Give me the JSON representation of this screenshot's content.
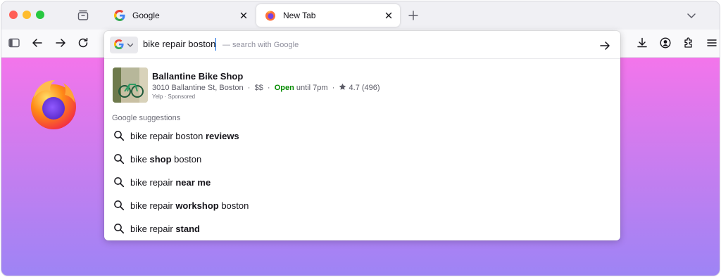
{
  "tabs": [
    {
      "title": "Google",
      "favicon": "google-g-icon",
      "active": false
    },
    {
      "title": "New Tab",
      "favicon": "firefox-icon",
      "active": true
    }
  ],
  "urlbar": {
    "value": "bike repair boston",
    "hint": "— search with Google",
    "engine_icon": "google-g-icon"
  },
  "business": {
    "name": "Ballantine Bike Shop",
    "address": "3010 Ballantine St, Boston",
    "price": "$$",
    "open_label": "Open",
    "hours": "until 7pm",
    "rating": "4.7",
    "reviews": "(496)",
    "source": "Yelp",
    "sponsored": "Sponsored"
  },
  "suggestions_label": "Google suggestions",
  "suggestions": [
    {
      "plain": "bike repair boston ",
      "bold": "reviews",
      "after": ""
    },
    {
      "plain": "bike ",
      "bold": "shop",
      "after": " boston"
    },
    {
      "plain": "bike repair ",
      "bold": "near me",
      "after": ""
    },
    {
      "plain": "bike repair ",
      "bold": "workshop",
      "after": " boston"
    },
    {
      "plain": "bike repair ",
      "bold": "stand",
      "after": ""
    }
  ],
  "colors": {
    "open": "#058b00",
    "gradient_top": "#f375eb",
    "gradient_bottom": "#9d84f5"
  }
}
